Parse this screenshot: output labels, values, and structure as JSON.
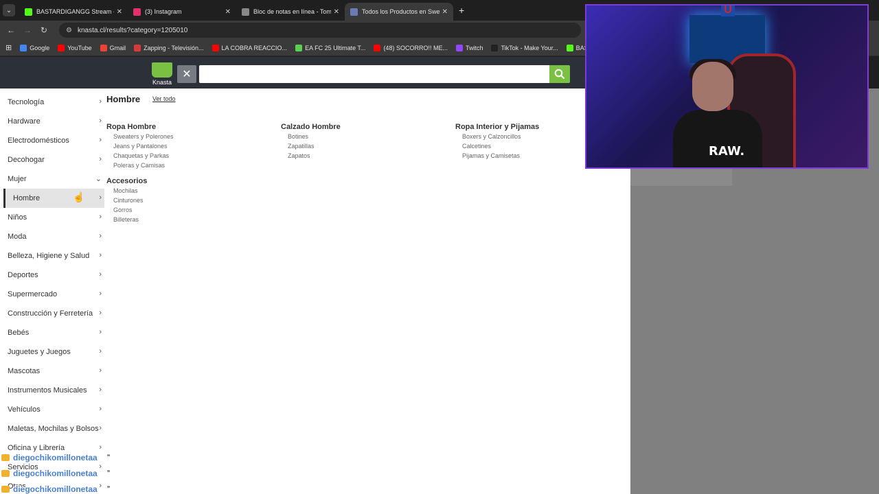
{
  "browser": {
    "tabs": [
      {
        "title": "BASTARDIGANGG Stream - Wa",
        "color": "#53fc18",
        "active": false
      },
      {
        "title": "(3) Instagram",
        "color": "#e1306c",
        "active": false
      },
      {
        "title": "Bloc de notas en línea - Toma y",
        "color": "#888888",
        "active": false
      },
      {
        "title": "Todos los Productos en Sweate",
        "color": "#6a7cb5",
        "active": true
      }
    ],
    "url": "knasta.cl/results?category=1205010",
    "bookmarks": [
      {
        "label": "Google",
        "color": "#4285f4"
      },
      {
        "label": "YouTube",
        "color": "#ff0000"
      },
      {
        "label": "Gmail",
        "color": "#ea4335"
      },
      {
        "label": "Zapping - Televisión...",
        "color": "#d93a3a"
      },
      {
        "label": "LA COBRA REACCIO...",
        "color": "#ff0000"
      },
      {
        "label": "EA FC 25 Ultimate T...",
        "color": "#5ccf50"
      },
      {
        "label": "(48) SOCORRO!! ME...",
        "color": "#ff0000"
      },
      {
        "label": "Twitch",
        "color": "#9146ff"
      },
      {
        "label": "TikTok - Make Your...",
        "color": "#222222"
      },
      {
        "label": "BASTARDIGANGG |...",
        "color": "#53fc18"
      }
    ]
  },
  "site": {
    "logo_text": "Knasta",
    "search_placeholder": ""
  },
  "sidebar": [
    {
      "label": "Tecnología",
      "chev": "›"
    },
    {
      "label": "Hardware",
      "chev": "›"
    },
    {
      "label": "Electrodomésticos",
      "chev": "›"
    },
    {
      "label": "Decohogar",
      "chev": "›"
    },
    {
      "label": "Mujer",
      "chev": "⌄"
    },
    {
      "label": "Hombre",
      "chev": "›",
      "active": true
    },
    {
      "label": "Niños",
      "chev": "›"
    },
    {
      "label": "Moda",
      "chev": "›"
    },
    {
      "label": "Belleza, Higiene y Salud",
      "chev": "›"
    },
    {
      "label": "Deportes",
      "chev": "›"
    },
    {
      "label": "Supermercado",
      "chev": "›"
    },
    {
      "label": "Construcción y Ferretería",
      "chev": "›"
    },
    {
      "label": "Bebés",
      "chev": "›"
    },
    {
      "label": "Juguetes y Juegos",
      "chev": "›"
    },
    {
      "label": "Mascotas",
      "chev": "›"
    },
    {
      "label": "Instrumentos Musicales",
      "chev": "›"
    },
    {
      "label": "Vehículos",
      "chev": "›"
    },
    {
      "label": "Maletas, Mochilas y Bolsos",
      "chev": "›"
    },
    {
      "label": "Oficina y Librería",
      "chev": "›"
    },
    {
      "label": "Servicios",
      "chev": "›"
    },
    {
      "label": "Otros",
      "chev": "›"
    }
  ],
  "menu": {
    "title": "Hombre",
    "see_all": "Ver todo",
    "columns": [
      {
        "groups": [
          {
            "heading": "Ropa Hombre",
            "items": [
              "Sweaters y Polerones",
              "Jeans y Pantalones",
              "Chaquetas y Parkas",
              "Poleras y Camisas"
            ]
          },
          {
            "heading": "Accesorios",
            "items": [
              "Mochilas",
              "Cinturones",
              "Gorros",
              "Billeteras"
            ]
          }
        ]
      },
      {
        "groups": [
          {
            "heading": "Calzado Hombre",
            "items": [
              "Botines",
              "Zapatillas",
              "Zapatos"
            ]
          }
        ]
      },
      {
        "groups": [
          {
            "heading": "Ropa Interior y Pijamas",
            "items": [
              "Boxers y Calzoncillos",
              "Calcetines",
              "Pijamas y Camisetas"
            ]
          }
        ]
      }
    ]
  },
  "stream": {
    "shirt_text": "RAW.",
    "badge": "U"
  },
  "chat": [
    {
      "user": "diegochikomillonetaa"
    },
    {
      "user": "diegochikomillonetaa"
    },
    {
      "user": "diegochikomillonetaa"
    }
  ]
}
